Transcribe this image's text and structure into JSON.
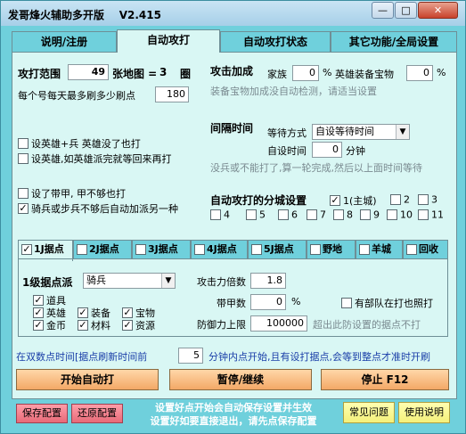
{
  "window": {
    "title": "发哥烽火辅助多开版",
    "version": "V2.415",
    "minimize_glyph": "—",
    "maximize_glyph": "□",
    "close_glyph": "✕"
  },
  "tabs": [
    {
      "label": "说明/注册"
    },
    {
      "label": "自动攻打"
    },
    {
      "label": "自动攻打状态"
    },
    {
      "label": "其它功能/全局设置"
    }
  ],
  "left": {
    "attack_range_label": "攻打范围",
    "attack_range_value": "49",
    "map_count_label": "张地图 =",
    "map_count_value": "3",
    "circle_label": "圈",
    "max_refresh_label": "每个号每天最多刷多少刷点",
    "max_refresh_value": "180",
    "checks": [
      {
        "label": "设英雄+兵 英雄没了也打",
        "checked": false
      },
      {
        "label": "设英雄,如英雄派完就等回来再打",
        "checked": false
      },
      {
        "label": "设了带甲, 甲不够也打",
        "checked": false
      },
      {
        "label": "骑兵或步兵不够后自动加派另一种",
        "checked": true
      }
    ]
  },
  "right": {
    "bonus_title": "攻击加成",
    "family_label": "家族",
    "family_value": "0",
    "family_unit": "%",
    "hero_treasure_label": "英雄装备宝物",
    "hero_treasure_value": "0",
    "hero_treasure_unit": "%",
    "bonus_note": "装备宝物加成没自动检测，请适当设置",
    "interval_title": "间隔时间",
    "wait_mode_label": "等待方式",
    "wait_mode_value": "自设等待时间",
    "custom_time_label": "自设时间",
    "custom_time_value": "0",
    "custom_time_unit": "分钟",
    "interval_note": "没兵或不能打了,算一轮完成,然后以上面时间等待",
    "city_title": "自动攻打的分城设置",
    "cities": [
      {
        "label": "1(主城)",
        "checked": true
      },
      {
        "label": "2",
        "checked": false
      },
      {
        "label": "3",
        "checked": false
      },
      {
        "label": "4",
        "checked": false
      },
      {
        "label": "5",
        "checked": false
      },
      {
        "label": "6",
        "checked": false
      },
      {
        "label": "7",
        "checked": false
      },
      {
        "label": "8",
        "checked": false
      },
      {
        "label": "9",
        "checked": false
      },
      {
        "label": "10",
        "checked": false
      },
      {
        "label": "11",
        "checked": false
      }
    ]
  },
  "inner_tabs": [
    {
      "label": "1J据点",
      "checked": true
    },
    {
      "label": "2J据点",
      "checked": false
    },
    {
      "label": "3J据点",
      "checked": false
    },
    {
      "label": "4J据点",
      "checked": false
    },
    {
      "label": "5J据点",
      "checked": false
    },
    {
      "label": "野地",
      "checked": false
    },
    {
      "label": "羊城",
      "checked": false
    },
    {
      "label": "回收",
      "checked": false
    }
  ],
  "stronghold": {
    "dispatch_label": "1级据点派",
    "dispatch_value": "骑兵",
    "items": [
      {
        "label": "道具",
        "checked": true
      },
      {
        "label": "英雄",
        "checked": true
      },
      {
        "label": "装备",
        "checked": true
      },
      {
        "label": "宝物",
        "checked": true
      },
      {
        "label": "金币",
        "checked": true
      },
      {
        "label": "材料",
        "checked": true
      },
      {
        "label": "资源",
        "checked": true
      }
    ],
    "attack_multiplier_label": "攻击力倍数",
    "attack_multiplier_value": "1.8",
    "armor_label": "带甲数",
    "armor_value": "0",
    "armor_unit": "%",
    "troops_attacking_label": "有部队在打也照打",
    "troops_attacking_checked": false,
    "defense_cap_label": "防御力上限",
    "defense_cap_value": "100000",
    "defense_cap_note": "超出此防设置的据点不打"
  },
  "refresh": {
    "before_label": "在双数点时间[据点刷新时间前",
    "minutes_value": "5",
    "after_label": "分钟内点开始,且有设打据点,会等到整点才准时开刷"
  },
  "buttons": {
    "start": "开始自动打",
    "pause": "暂停/继续",
    "stop": "停止 F12",
    "save_config": "保存配置",
    "restore_config": "还原配置",
    "faq": "常见问题",
    "manual": "使用说明"
  },
  "footer_note_1": "设置好点开始会自动保存设置并生效",
  "footer_note_2": "设置好如要直接退出，请先点保存配置",
  "colors": {
    "window_bg": "#6fd0dc",
    "panel_bg": "#d9f7f4",
    "text_blue": "#1a3ea8"
  }
}
